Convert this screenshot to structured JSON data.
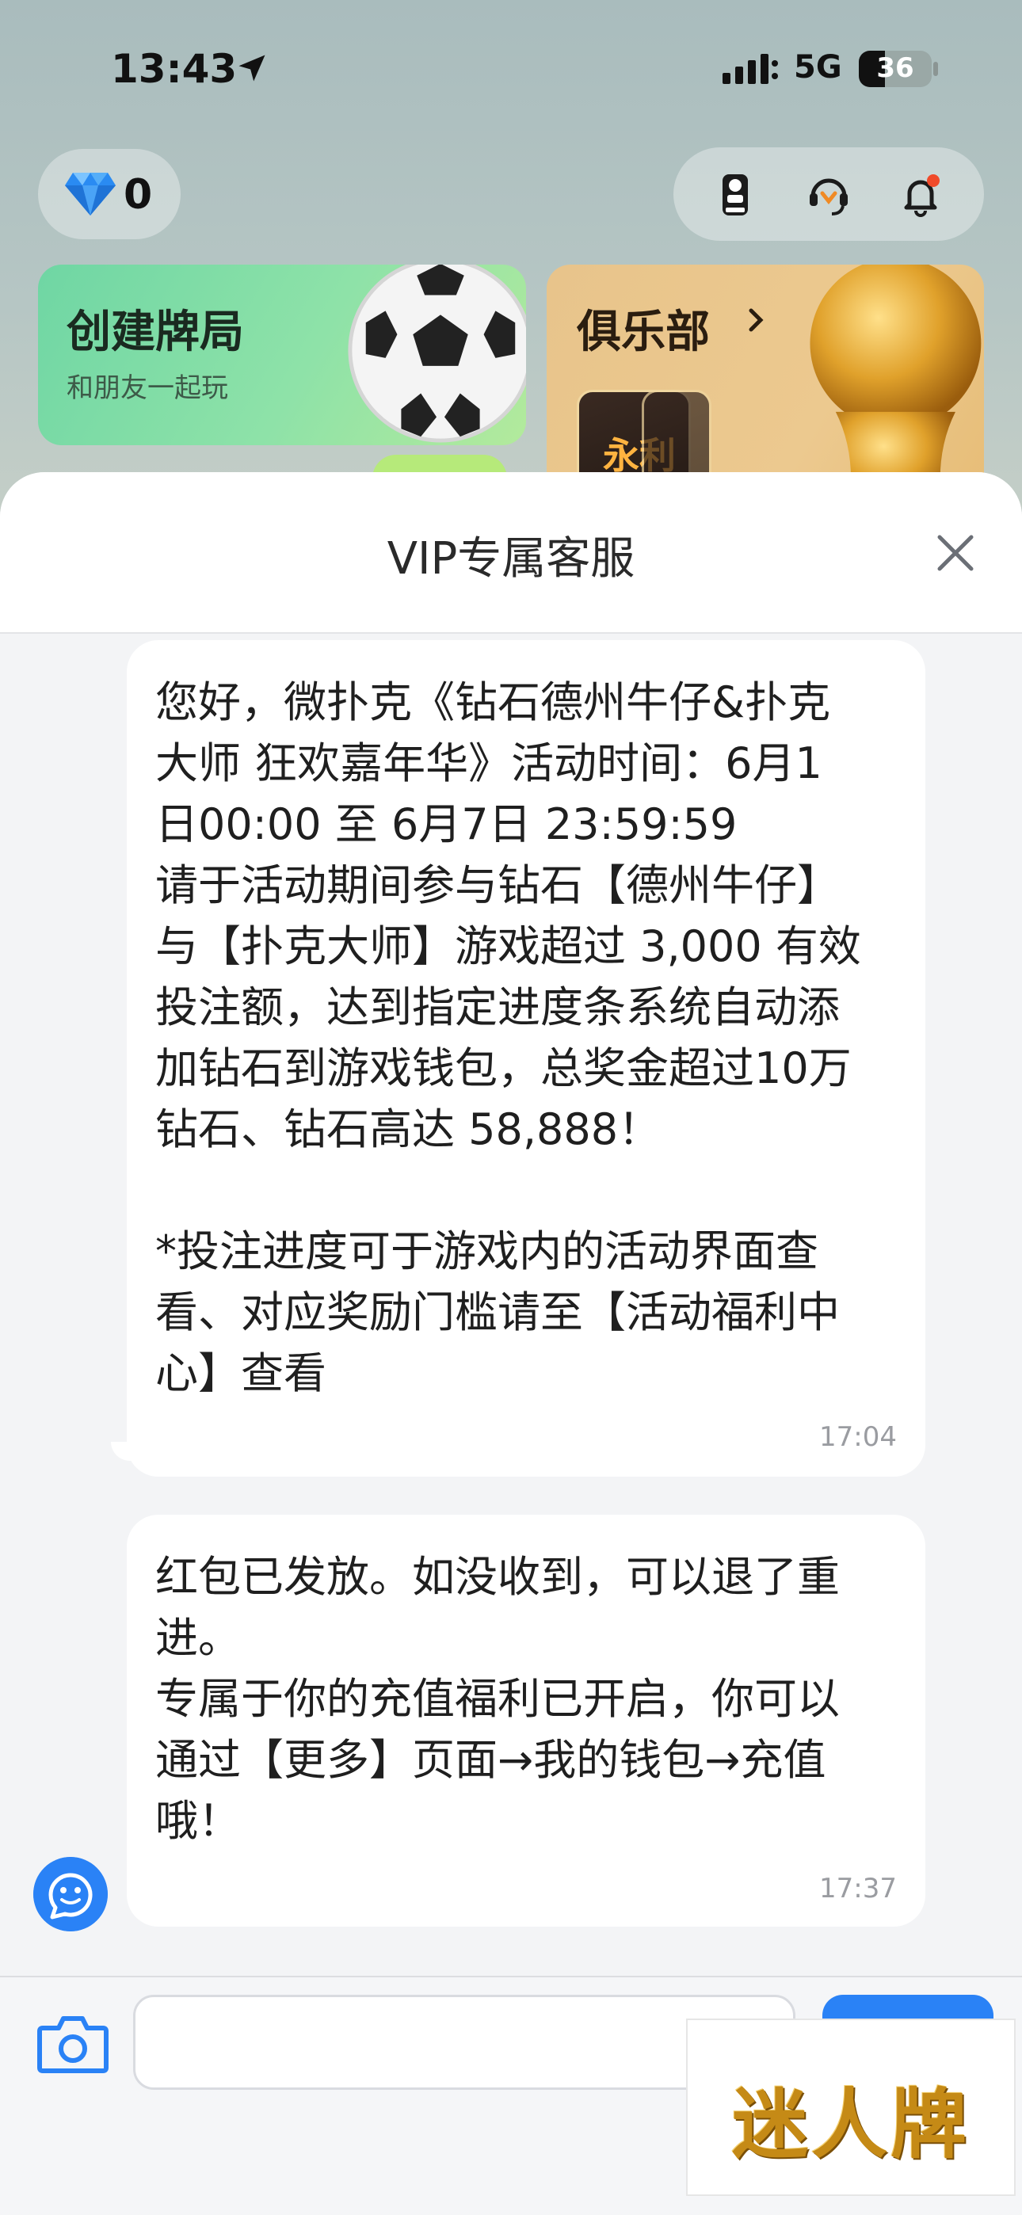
{
  "status_bar": {
    "time": "13:43",
    "network": "5G",
    "battery": "36"
  },
  "background": {
    "gem_count": "0",
    "create_card": {
      "title": "创建牌局",
      "subtitle": "和朋友一起玩"
    },
    "club_card": {
      "title": "俱乐部",
      "thumb_text": "永利"
    },
    "icons": [
      "fifa-icon",
      "support-agent-icon",
      "bell-icon"
    ]
  },
  "sheet": {
    "title": "VIP专属客服",
    "messages": [
      {
        "text": "您好，微扑克《钻石德州牛仔&扑克\n大师 狂欢嘉年华》活动时间：6月1\n日00:00 至 6月7日 23:59:59\n请于活动期间参与钻石【德州牛仔】\n与【扑克大师】游戏超过 3,000 有效\n投注额，达到指定进度条系统自动添\n加钻石到游戏钱包，总奖金超过10万\n钻石、钻石高达 58,888！\n\n*投注进度可于游戏内的活动界面查\n看、对应奖励门槛请至【活动福利中\n心】查看",
        "time": "17:04"
      },
      {
        "text": "红包已发放。如没收到，可以退了重\n进。\n专属于你的充值福利已开启，你可以\n通过【更多】页面→我的钱包→充值\n哦！",
        "time": "17:37"
      }
    ]
  },
  "input_bar": {
    "value": "",
    "placeholder": ""
  },
  "watermark": {
    "text": "迷人牌"
  },
  "colors": {
    "accent": "#2a82f6",
    "sheet_bg": "#f3f4f6",
    "bubble_bg": "#ffffff"
  }
}
